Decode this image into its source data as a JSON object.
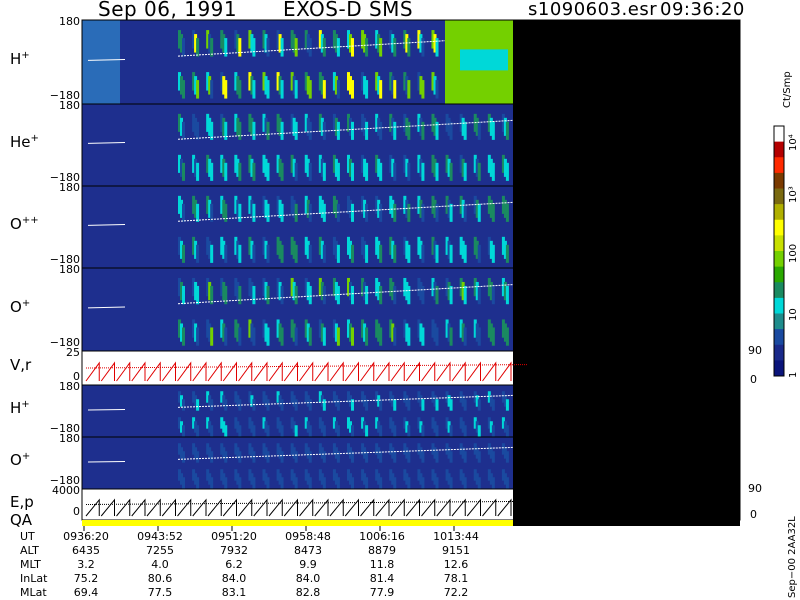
{
  "header": {
    "date": "Sep 06, 1991",
    "instrument": "EXOS-D SMS",
    "file": "s1090603.esr",
    "time": "09:36:20"
  },
  "panels": [
    {
      "id": "h_plus",
      "label": "H",
      "sup": "+",
      "top": "180",
      "bottom": "−180",
      "kind": "spectro",
      "ring": "#80cc3c",
      "intensity": 0.9
    },
    {
      "id": "he_plus",
      "label": "He",
      "sup": "+",
      "top": "180",
      "bottom": "−180",
      "kind": "spectro",
      "ring": "#3aa7b9",
      "intensity": 0.5
    },
    {
      "id": "o_pp",
      "label": "O",
      "sup": "++",
      "top": "180",
      "bottom": "−180",
      "kind": "spectro",
      "ring": "#3aa7b9",
      "intensity": 0.55
    },
    {
      "id": "o_plus",
      "label": "O",
      "sup": "+",
      "top": "180",
      "bottom": "−180",
      "kind": "spectro",
      "ring": "#4cbf7c",
      "intensity": 0.6
    },
    {
      "id": "vr",
      "label": "V,r",
      "sup": "",
      "top": "25",
      "bottom": "0",
      "right_top": "90",
      "right_bottom": "0",
      "kind": "line"
    },
    {
      "id": "h_plus_2",
      "label": "H",
      "sup": "+",
      "top": "180",
      "bottom": "−180",
      "kind": "spectro",
      "ring": "#1f4aa6",
      "intensity": 0.2
    },
    {
      "id": "o_plus_2",
      "label": "O",
      "sup": "+",
      "top": "180",
      "bottom": "−180",
      "kind": "spectro",
      "ring": "#1f4aa6",
      "intensity": 0.15
    },
    {
      "id": "ep",
      "label": "E,p",
      "sup": "",
      "top": "4000",
      "bottom": "0",
      "right_top": "90",
      "right_bottom": "0",
      "kind": "line"
    }
  ],
  "qa_label": "QA",
  "colorbar": {
    "title": "Ct/Smp",
    "ticks": [
      "10⁴",
      "10³",
      "100",
      "10",
      "1"
    ],
    "colors": [
      "#ffffff",
      "#b40000",
      "#ff2a00",
      "#7a3a00",
      "#7a6a10",
      "#b0b000",
      "#ffff00",
      "#c8e000",
      "#74d000",
      "#2aa800",
      "#1a8a60",
      "#00d8d8",
      "#1e8c8c",
      "#1a4aa0",
      "#1a2a8a",
      "#0a147a"
    ]
  },
  "footer": {
    "rows": [
      {
        "name": "UT",
        "values": [
          "0936:20",
          "0943:52",
          "0951:20",
          "0958:48",
          "1006:16",
          "1013:44"
        ]
      },
      {
        "name": "ALT",
        "values": [
          "6435",
          "7255",
          "7932",
          "8473",
          "8879",
          "9151"
        ]
      },
      {
        "name": "MLT",
        "values": [
          "3.2",
          "4.0",
          "6.2",
          "9.9",
          "11.8",
          "12.6"
        ]
      },
      {
        "name": "InLat",
        "values": [
          "75.2",
          "80.6",
          "84.0",
          "84.0",
          "81.4",
          "78.1"
        ]
      },
      {
        "name": "MLat",
        "values": [
          "69.4",
          "77.5",
          "83.1",
          "82.8",
          "77.9",
          "72.2"
        ]
      }
    ],
    "side_note": "Sep−00 2AA32L"
  },
  "chart_data": {
    "type": "heatmap",
    "title": "Sep 06, 1991   EXOS-D SMS",
    "x_ticks": [
      "0936:20",
      "0943:52",
      "0951:20",
      "0958:48",
      "1006:16",
      "1013:44"
    ],
    "panels": [
      "H+",
      "He+",
      "O++",
      "O+",
      "V,r",
      "H+",
      "O+",
      "E,p"
    ],
    "pitch_angle_range": [
      -180,
      180
    ],
    "vr_range": [
      0,
      25
    ],
    "ep_range": [
      0,
      4000
    ],
    "right_axis_range": [
      0,
      90
    ],
    "colorbar_units": "Ct/Smp",
    "colorbar_scale": "log",
    "colorbar_range": [
      1,
      10000
    ]
  }
}
